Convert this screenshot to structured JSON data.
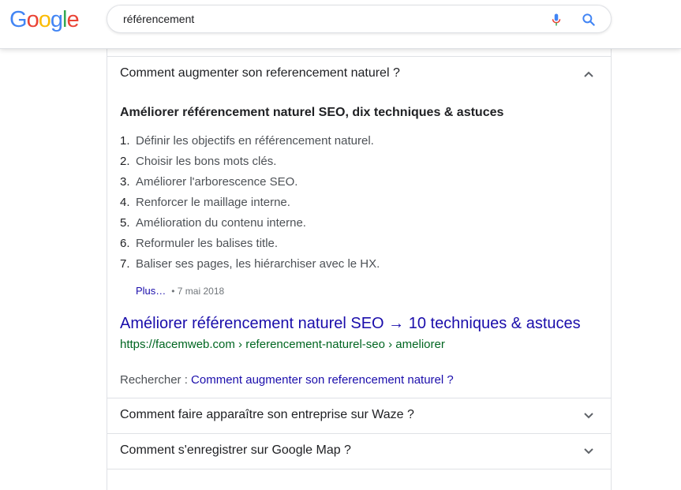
{
  "header": {
    "logo_letters": [
      "G",
      "o",
      "o",
      "g",
      "l",
      "e"
    ],
    "search_value": "référencement",
    "mic_icon": "microphone-icon",
    "search_icon": "magnifier-icon",
    "colors": {
      "blue": "#4285F4",
      "red": "#EA4335",
      "yellow": "#FBBC05",
      "green": "#34A853"
    }
  },
  "faq": {
    "expanded": {
      "question": "Comment augmenter son referencement naturel ?",
      "answer_title": "Améliorer référencement naturel SEO, dix techniques & astuces",
      "steps": [
        {
          "num": "1.",
          "text": "Définir les objectifs en référencement naturel."
        },
        {
          "num": "2.",
          "text": "Choisir les bons mots clés."
        },
        {
          "num": "3.",
          "text": "Améliorer l'arborescence SEO."
        },
        {
          "num": "4.",
          "text": "Renforcer le maillage interne."
        },
        {
          "num": "5.",
          "text": "Amélioration du contenu interne."
        },
        {
          "num": "6.",
          "text": "Reformuler les balises title."
        },
        {
          "num": "7.",
          "text": "Baliser ses pages, les hiérarchiser avec le HX."
        }
      ],
      "more_link": "Plus…",
      "date": "7 mai 2018",
      "result_title": "Améliorer référencement naturel SEO → 10 techniques & astuces",
      "result_url": "https://facemweb.com › referencement-naturel-seo › ameliorer",
      "search_for_label": "Rechercher : ",
      "search_for_link": "Comment augmenter son referencement naturel ?"
    },
    "collapsed": [
      {
        "question": "Comment faire apparaître son entreprise sur Waze ?"
      },
      {
        "question": "Comment s'enregistrer sur Google Map ?"
      }
    ]
  }
}
